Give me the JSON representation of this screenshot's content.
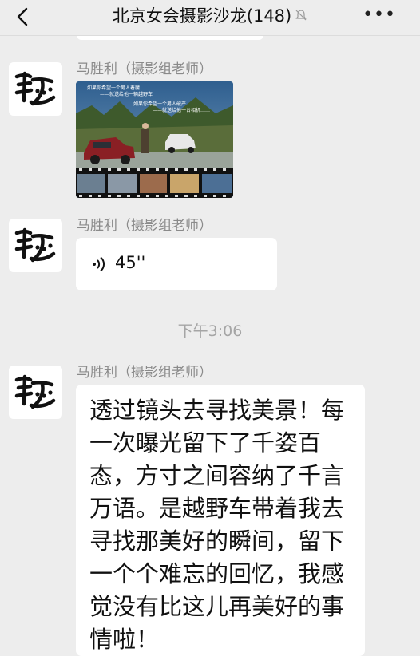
{
  "header": {
    "title": "北京女会摄影沙龙(148)",
    "back_icon": "chevron-left-icon",
    "mute_icon": "bell-off-icon",
    "more_icon": "more-dots-icon",
    "more_label": "•••"
  },
  "messages": [
    {
      "sender": "马胜利（摄影组老师）",
      "type": "image",
      "image_caption_lines": [
        "如果你希望一个男人着魔",
        "——就送给他一辆越野车",
        "如果你希望一个男人破产",
        "——就送给他一台相机……"
      ]
    },
    {
      "sender": "马胜利（摄影组老师）",
      "type": "voice",
      "duration": "45''"
    },
    {
      "type": "timestamp",
      "text": "下午3:06"
    },
    {
      "sender": "马胜利（摄影组老师）",
      "type": "text",
      "text": "透过镜头去寻找美景！每一次曝光留下了千姿百态，方寸之间容纳了千言万语。是越野车带着我去寻找那美好的瞬间，留下一个个难忘的回忆，我感觉没有比这儿再美好的事情啦！"
    }
  ],
  "colors": {
    "background": "#ededed",
    "bubble": "#ffffff",
    "sender": "#8a8a8a",
    "timestamp": "#a5a5a5"
  }
}
